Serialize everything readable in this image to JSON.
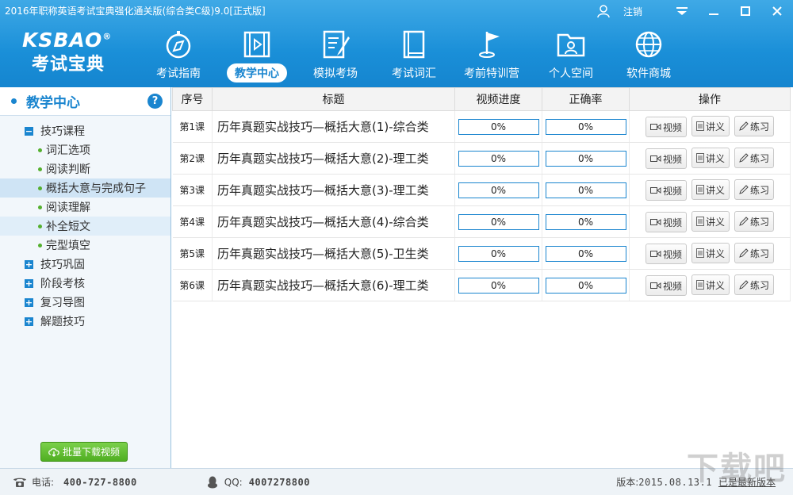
{
  "window": {
    "title": "2016年职称英语考试宝典强化通关版(综合类C级)9.0[正式版]",
    "logout_label": "注销"
  },
  "logo": {
    "line1": "KSBAO",
    "reg": "®",
    "line2": "考试宝典"
  },
  "nav": [
    {
      "label": "考试指南",
      "icon": "compass-icon"
    },
    {
      "label": "教学中心",
      "icon": "video-icon",
      "active": true
    },
    {
      "label": "模拟考场",
      "icon": "exam-icon"
    },
    {
      "label": "考试词汇",
      "icon": "book-icon"
    },
    {
      "label": "考前特训营",
      "icon": "flag-icon"
    },
    {
      "label": "个人空间",
      "icon": "folder-user-icon"
    },
    {
      "label": "软件商城",
      "icon": "globe-icon"
    }
  ],
  "sidebar": {
    "heading": "教学中心",
    "help": "?",
    "groups": [
      {
        "label": "技巧课程",
        "expanded": true,
        "items": [
          "词汇选项",
          "阅读判断",
          "概括大意与完成句子",
          "阅读理解",
          "补全短文",
          "完型填空"
        ]
      },
      {
        "label": "技巧巩固"
      },
      {
        "label": "阶段考核"
      },
      {
        "label": "复习导图"
      },
      {
        "label": "解题技巧"
      }
    ],
    "download_label": "批量下载视频"
  },
  "table": {
    "headers": [
      "序号",
      "标题",
      "视频进度",
      "正确率",
      "操作"
    ],
    "op_labels": {
      "video": "视频",
      "notes": "讲义",
      "practice": "练习"
    },
    "rows": [
      {
        "num": "第1课",
        "title": "历年真题实战技巧—概括大意(1)-综合类",
        "progress": "0%",
        "accuracy": "0%"
      },
      {
        "num": "第2课",
        "title": "历年真题实战技巧—概括大意(2)-理工类",
        "progress": "0%",
        "accuracy": "0%"
      },
      {
        "num": "第3课",
        "title": "历年真题实战技巧—概括大意(3)-理工类",
        "progress": "0%",
        "accuracy": "0%"
      },
      {
        "num": "第4课",
        "title": "历年真题实战技巧—概括大意(4)-综合类",
        "progress": "0%",
        "accuracy": "0%"
      },
      {
        "num": "第5课",
        "title": "历年真题实战技巧—概括大意(5)-卫生类",
        "progress": "0%",
        "accuracy": "0%"
      },
      {
        "num": "第6课",
        "title": "历年真题实战技巧—概括大意(6)-理工类",
        "progress": "0%",
        "accuracy": "0%"
      }
    ]
  },
  "footer": {
    "phone_label": "电话:",
    "phone": "400-727-8800",
    "qq_label": "QQ:",
    "qq": "4007278800",
    "version_label": "版本:",
    "version": "2015.08.13.1",
    "update_status": "已是最新版本"
  },
  "watermark": "下载吧",
  "colors": {
    "brand": "#1a85cf",
    "green": "#55b02f"
  }
}
